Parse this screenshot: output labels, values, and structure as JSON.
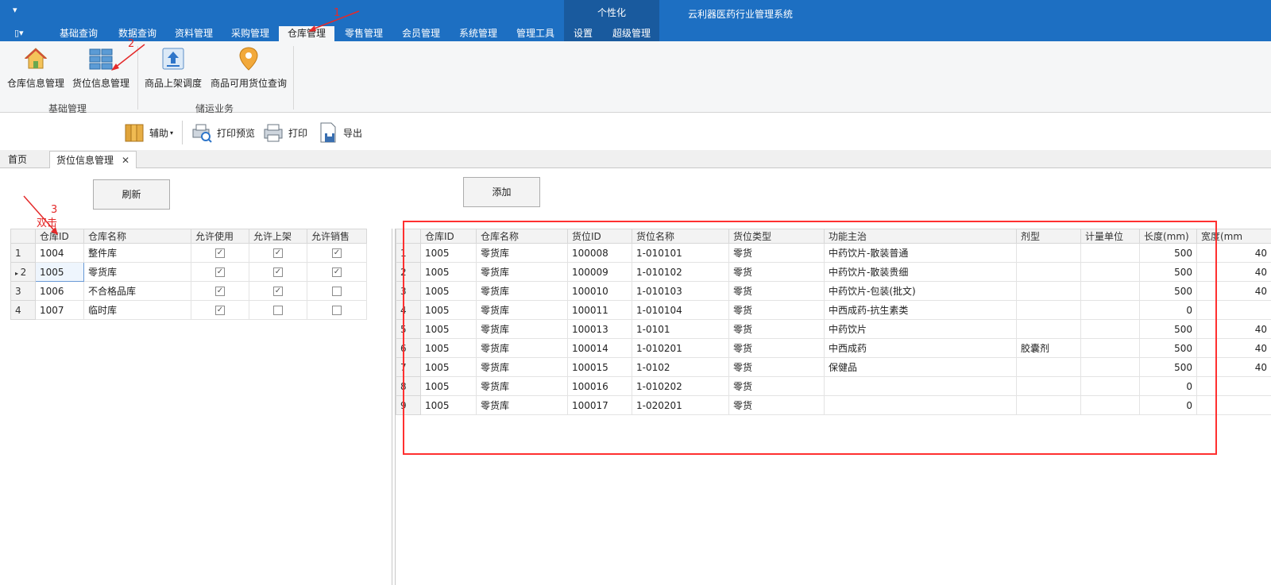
{
  "titlebar": {
    "app_title": "云利器医药行业管理系统",
    "contextual_group": "个性化",
    "qat_symbol": "▾",
    "file_symbol": "▯▾"
  },
  "tabs": [
    "基础查询",
    "数据查询",
    "资料管理",
    "采购管理",
    "仓库管理",
    "零售管理",
    "会员管理",
    "系统管理",
    "管理工具",
    "设置",
    "超级管理"
  ],
  "active_tab": "仓库管理",
  "ribbon": {
    "buttons": [
      "仓库信息管理",
      "货位信息管理",
      "商品上架调度",
      "商品可用货位查询"
    ],
    "groups": [
      "基础管理",
      "储运业务"
    ]
  },
  "toolbar": {
    "assist": "辅助",
    "print_preview": "打印预览",
    "print": "打印",
    "export": "导出"
  },
  "doc_tabs": {
    "home": "首页",
    "active": "货位信息管理",
    "close": "✕"
  },
  "buttons": {
    "refresh": "刷新",
    "add": "添加"
  },
  "annotations": {
    "step1": "1",
    "step2": "2",
    "step3": "3",
    "double_click": "双击"
  },
  "left_grid": {
    "columns": [
      "仓库ID",
      "仓库名称",
      "允许使用",
      "允许上架",
      "允许销售"
    ],
    "rows": [
      {
        "n": "1",
        "id": "1004",
        "name": "整件库",
        "use": true,
        "shelve": true,
        "sell": true
      },
      {
        "n": "2",
        "id": "1005",
        "name": "零货库",
        "use": true,
        "shelve": true,
        "sell": true
      },
      {
        "n": "3",
        "id": "1006",
        "name": "不合格品库",
        "use": true,
        "shelve": true,
        "sell": false
      },
      {
        "n": "4",
        "id": "1007",
        "name": "临时库",
        "use": true,
        "shelve": false,
        "sell": false
      }
    ],
    "selected_row": 1
  },
  "right_grid": {
    "columns": [
      "仓库ID",
      "仓库名称",
      "货位ID",
      "货位名称",
      "货位类型",
      "功能主治",
      "剂型",
      "计量单位",
      "长度(mm)",
      "宽度(mm"
    ],
    "rows": [
      {
        "n": "1",
        "wid": "1005",
        "wname": "零货库",
        "lid": "100008",
        "lname": "1-010101",
        "ltype": "零货",
        "func": "中药饮片-散装普通",
        "form": "",
        "unit": "",
        "len": "500",
        "wid2": "40"
      },
      {
        "n": "2",
        "wid": "1005",
        "wname": "零货库",
        "lid": "100009",
        "lname": "1-010102",
        "ltype": "零货",
        "func": "中药饮片-散装贵细",
        "form": "",
        "unit": "",
        "len": "500",
        "wid2": "40"
      },
      {
        "n": "3",
        "wid": "1005",
        "wname": "零货库",
        "lid": "100010",
        "lname": "1-010103",
        "ltype": "零货",
        "func": "中药饮片-包装(批文)",
        "form": "",
        "unit": "",
        "len": "500",
        "wid2": "40"
      },
      {
        "n": "4",
        "wid": "1005",
        "wname": "零货库",
        "lid": "100011",
        "lname": "1-010104",
        "ltype": "零货",
        "func": "中西成药-抗生素类",
        "form": "",
        "unit": "",
        "len": "0",
        "wid2": ""
      },
      {
        "n": "5",
        "wid": "1005",
        "wname": "零货库",
        "lid": "100013",
        "lname": "1-0101",
        "ltype": "零货",
        "func": "中药饮片",
        "form": "",
        "unit": "",
        "len": "500",
        "wid2": "40"
      },
      {
        "n": "6",
        "wid": "1005",
        "wname": "零货库",
        "lid": "100014",
        "lname": "1-010201",
        "ltype": "零货",
        "func": "中西成药",
        "form": "胶囊剂",
        "unit": "",
        "len": "500",
        "wid2": "40"
      },
      {
        "n": "7",
        "wid": "1005",
        "wname": "零货库",
        "lid": "100015",
        "lname": "1-0102",
        "ltype": "零货",
        "func": "保健品",
        "form": "",
        "unit": "",
        "len": "500",
        "wid2": "40"
      },
      {
        "n": "8",
        "wid": "1005",
        "wname": "零货库",
        "lid": "100016",
        "lname": "1-010202",
        "ltype": "零货",
        "func": "",
        "form": "",
        "unit": "",
        "len": "0",
        "wid2": ""
      },
      {
        "n": "9",
        "wid": "1005",
        "wname": "零货库",
        "lid": "100017",
        "lname": "1-020201",
        "ltype": "零货",
        "func": "",
        "form": "",
        "unit": "",
        "len": "0",
        "wid2": ""
      }
    ]
  },
  "colors": {
    "titlebar": "#1d6fc2",
    "contextual": "#195a9e",
    "annotation": "#e42a2a"
  }
}
